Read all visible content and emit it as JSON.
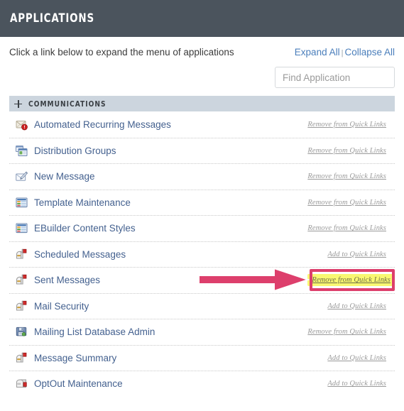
{
  "window": {
    "title": "APPLICATIONS",
    "header_bg": "#4b545d"
  },
  "intro": {
    "text": "Click a link below to expand the menu of applications",
    "expand_all": "Expand All",
    "separator": "|",
    "collapse_all": "Collapse All",
    "link_color": "#4a7ebb"
  },
  "search": {
    "placeholder": "Find Application",
    "value": ""
  },
  "section": {
    "title": "COMMUNICATIONS",
    "expand_icon": "plus-icon",
    "bg": "#ccd5de"
  },
  "annotation": {
    "arrow_color": "#dd3f6c",
    "highlight_color": "#f9f871",
    "box_border_color": "#dd3f6c",
    "target_row": "Sent Messages",
    "target_link": "Remove from Quick Links"
  },
  "apps": [
    {
      "name": "Automated Recurring Messages",
      "icon": "envelope-alert-icon",
      "action": "Remove from Quick Links",
      "highlighted": false
    },
    {
      "name": "Distribution Groups",
      "icon": "windows-group-icon",
      "action": "Remove from Quick Links",
      "highlighted": false
    },
    {
      "name": "New Message",
      "icon": "compose-pencil-icon",
      "action": "Remove from Quick Links",
      "highlighted": false
    },
    {
      "name": "Template Maintenance",
      "icon": "template-grid-icon",
      "action": "Remove from Quick Links",
      "highlighted": false
    },
    {
      "name": "EBuilder Content Styles",
      "icon": "template-grid-icon",
      "action": "Remove from Quick Links",
      "highlighted": false
    },
    {
      "name": "Scheduled Messages",
      "icon": "mailbox-flag-icon",
      "action": "Add to Quick Links",
      "highlighted": false
    },
    {
      "name": "Sent Messages",
      "icon": "mailbox-flag-icon",
      "action": "Remove from Quick Links",
      "highlighted": true
    },
    {
      "name": "Mail Security",
      "icon": "mailbox-flag-icon",
      "action": "Add to Quick Links",
      "highlighted": false
    },
    {
      "name": "Mailing List Database Admin",
      "icon": "database-disk-icon",
      "action": "Remove from Quick Links",
      "highlighted": false
    },
    {
      "name": "Message Summary",
      "icon": "mailbox-flag-icon",
      "action": "Add to Quick Links",
      "highlighted": false
    },
    {
      "name": "OptOut Maintenance",
      "icon": "mailbox-closed-icon",
      "action": "Add to Quick Links",
      "highlighted": false
    }
  ]
}
